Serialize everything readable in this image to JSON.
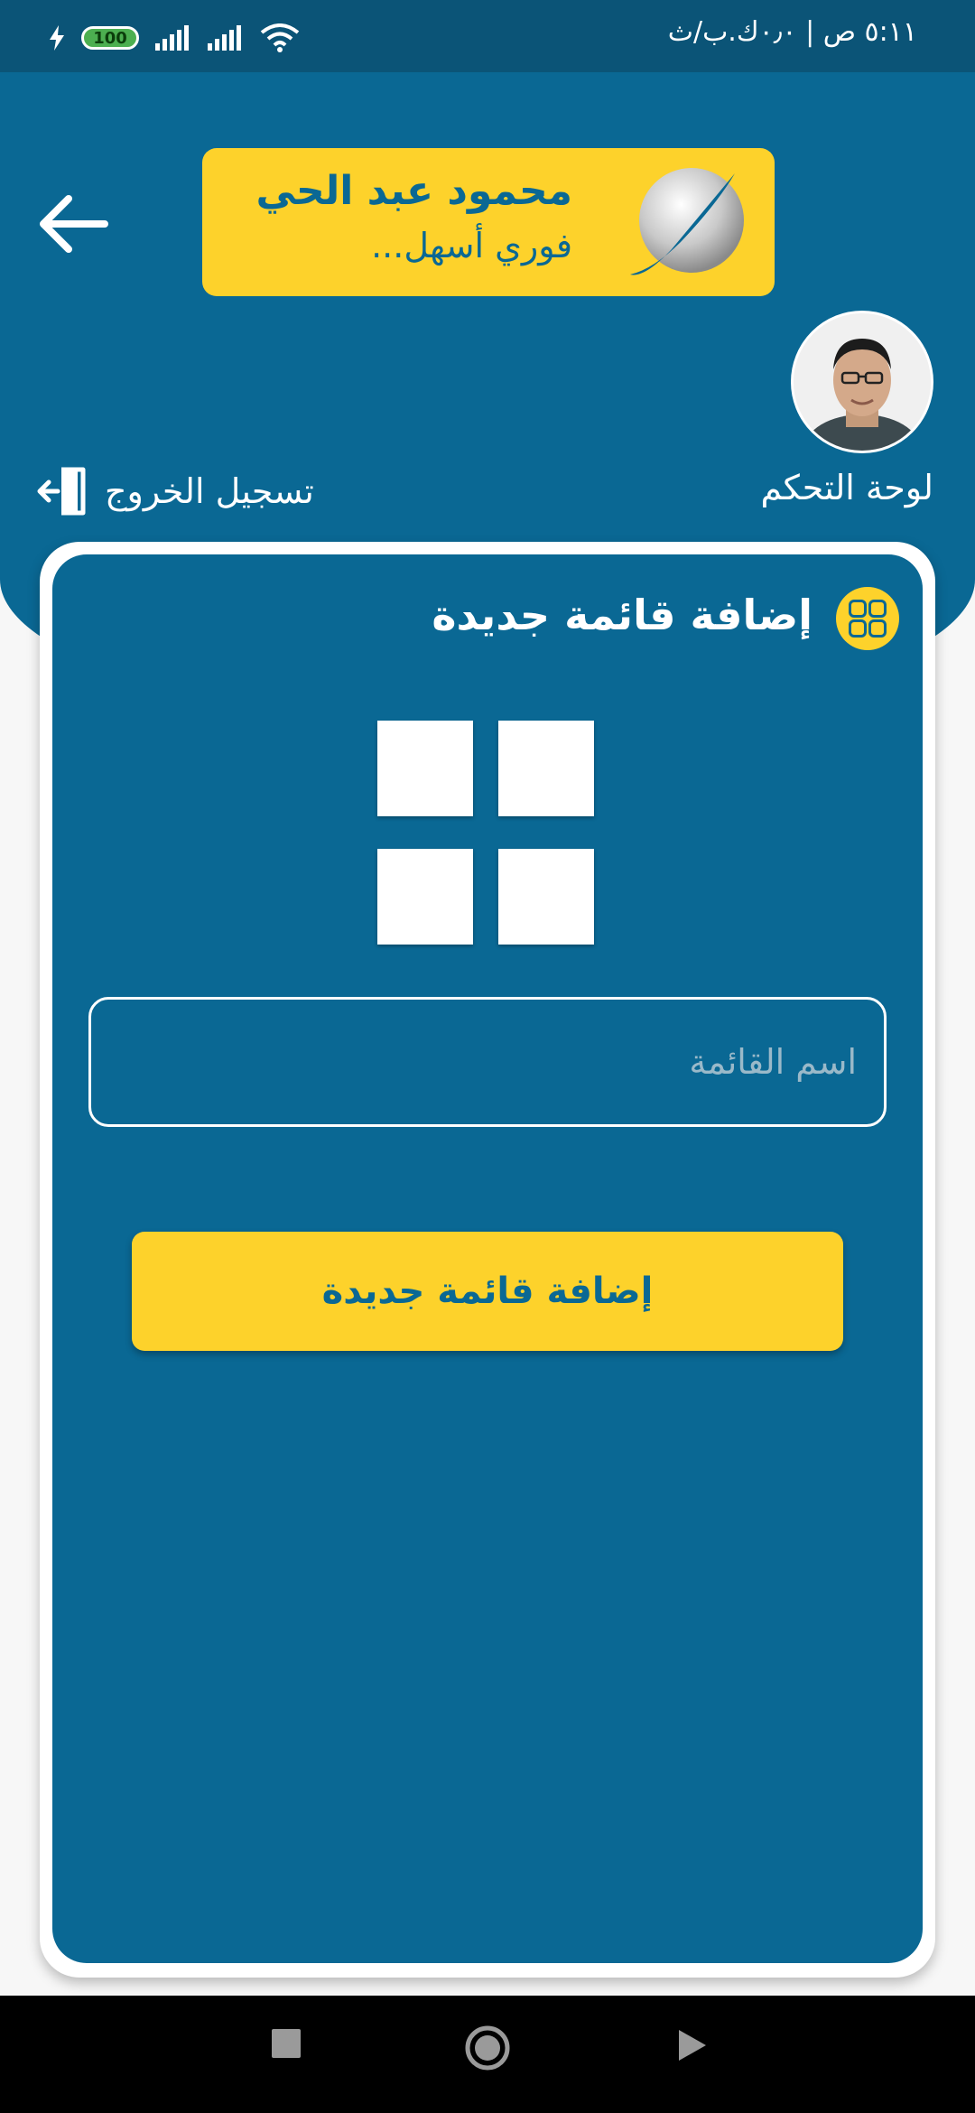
{
  "status_bar": {
    "time": "٥:١١ ص | ٠٫٠ك.ب/ث",
    "battery": "100"
  },
  "icons": {
    "back": "arrow-left-icon",
    "logout": "logout-icon",
    "title": "grid-icon",
    "list_placeholder": "grid-icon",
    "nav_recents": "square-icon",
    "nav_home": "circle-icon",
    "nav_back": "triangle-icon"
  },
  "colors": {
    "primary": "#0a6894",
    "accent": "#fdd22b",
    "status_bar": "#0b5477"
  },
  "header": {
    "logo_name": "محمود عبد الحي",
    "logo_tagline": "فوري أسهل..."
  },
  "nav": {
    "dashboard": "لوحة التحكم",
    "logout": "تسجيل الخروج"
  },
  "card": {
    "title": "إضافة قائمة جديدة",
    "input_placeholder": "اسم القائمة",
    "input_value": "",
    "submit_label": "إضافة قائمة جديدة"
  }
}
